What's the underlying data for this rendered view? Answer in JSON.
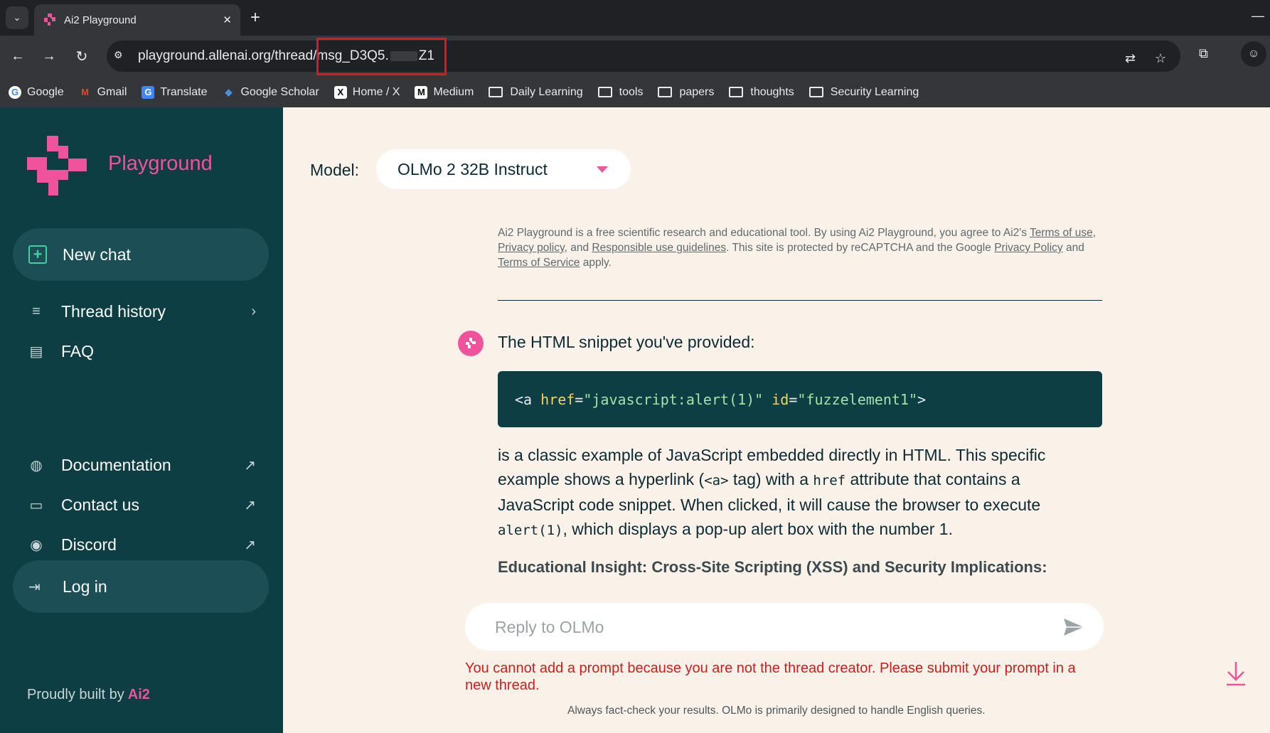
{
  "browser": {
    "tab_title": "Ai2 Playground",
    "tab_close": "✕",
    "new_tab": "+",
    "url_prefix": "playground.allenai.org/thread/msg_D3Q5.",
    "url_suffix": "Z1",
    "bookmarks": [
      {
        "label": "Google",
        "icon": "google-icon"
      },
      {
        "label": "Gmail",
        "icon": "gmail-icon"
      },
      {
        "label": "Translate",
        "icon": "translate-icon"
      },
      {
        "label": "Google Scholar",
        "icon": "scholar-icon"
      },
      {
        "label": "Home / X",
        "icon": "x-icon"
      },
      {
        "label": "Medium",
        "icon": "medium-icon"
      },
      {
        "label": "Daily Learning",
        "icon": "folder-icon"
      },
      {
        "label": "tools",
        "icon": "folder-icon"
      },
      {
        "label": "papers",
        "icon": "folder-icon"
      },
      {
        "label": "thoughts",
        "icon": "folder-icon"
      },
      {
        "label": "Security Learning",
        "icon": "folder-icon"
      }
    ]
  },
  "sidebar": {
    "brand": "Playground",
    "new_chat": "New chat",
    "thread_history": "Thread history",
    "faq": "FAQ",
    "documentation": "Documentation",
    "contact_us": "Contact us",
    "discord": "Discord",
    "log_in": "Log in",
    "built_by": "Proudly built by",
    "built_by_brand": "Ai2"
  },
  "main": {
    "model_label": "Model:",
    "model_value": "OLMo 2 32B Instruct",
    "disclaimer": {
      "t1": "Ai2 Playground is a free scientific research and educational tool. By using Ai2 Playground, you agree to Ai2's ",
      "terms_of_use": "Terms of use",
      "t2": ", ",
      "privacy_policy": "Privacy policy",
      "t3": ", and ",
      "responsible_use": "Responsible use guidelines",
      "t4": ". This site is protected by reCAPTCHA and the Google ",
      "google_privacy": "Privacy Policy",
      "t5": " and ",
      "terms_of_service": "Terms of Service",
      "t6": " apply."
    },
    "message": {
      "intro": "The HTML snippet you've provided:",
      "code": {
        "open": "<a ",
        "href_attr": "href",
        "eq1": "=",
        "href_val": "\"javascript:alert(1)\"",
        "sp": " ",
        "id_attr": "id",
        "eq2": "=",
        "id_val": "\"fuzzelement1\"",
        "close": ">"
      },
      "p1": "is a classic example of JavaScript embedded directly in HTML. This specific example shows a hyperlink (",
      "code_a": "<a>",
      "p2": " tag) with a ",
      "code_href": "href",
      "p3": " attribute that contains a JavaScript code snippet. When clicked, it will cause the browser to execute ",
      "code_alert": "alert(1)",
      "p4": ", which displays a pop-up alert box with the number 1.",
      "insight": "Educational Insight: Cross-Site Scripting (XSS) and Security Implications:"
    },
    "reply_placeholder": "Reply to OLMo",
    "error": "You cannot add a prompt because you are not the thread creator. Please submit your prompt in a new thread.",
    "footnote": "Always fact-check your results. OLMo is primarily designed to handle English queries."
  },
  "colors": {
    "sidebar_bg": "#0c3e44",
    "accent_pink": "#f0529c",
    "main_bg": "#faf2e9",
    "error_red": "#d11c1c",
    "highlight_red": "#e5141a"
  }
}
